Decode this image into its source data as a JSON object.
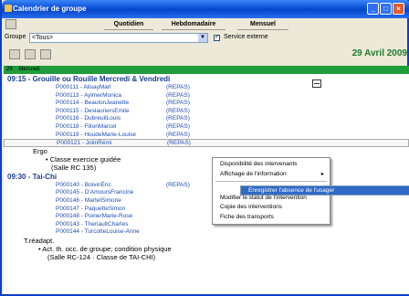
{
  "window": {
    "title": "Calendrier de groupe"
  },
  "views": {
    "daily": "Quotidien",
    "weekly": "Hebdomadaire",
    "monthly": "Mensuel"
  },
  "group": {
    "label": "Groupe",
    "value": "<Tous>",
    "service_label": "Service externe",
    "service_checked": true
  },
  "date": "29 Avril 2009",
  "header_day": {
    "num": "29",
    "name": "Mercredi"
  },
  "sessions": [
    {
      "time": "09:15 - Grouille ou Rouille Mercredi & Vendredi",
      "participants": [
        {
          "id": "P000111 - AlisayMarl",
          "tag": "(REPAS)"
        },
        {
          "id": "P000113 - AylmerMonica",
          "tag": "(REPAS)"
        },
        {
          "id": "P000114 - BeaulonJeanette",
          "tag": "(REPAS)"
        },
        {
          "id": "P000115 - DeslauriersEmile",
          "tag": "(REPAS)"
        },
        {
          "id": "P000116 - DubreuilLouis",
          "tag": "(REPAS)"
        },
        {
          "id": "P000118 - FilionMarcel",
          "tag": "(REPAS)"
        },
        {
          "id": "P000119 - HoudeMarie-Louise",
          "tag": "(REPAS)"
        },
        {
          "id": "P000121 - JolinRémi",
          "tag": "(REPAS)"
        }
      ],
      "staff": "Ergo",
      "notes": [
        "• Classe exercice guidée",
        "(Salle RC 135)"
      ]
    },
    {
      "time": "09:30 - Tai-Chi",
      "participants": [
        {
          "id": "P000140 - BoivinÉric",
          "tag": "(REPAS)"
        },
        {
          "id": "P000145 - D'AmoursFrancine",
          "tag": ""
        },
        {
          "id": "P000146 - MartelSimone",
          "tag": ""
        },
        {
          "id": "P000147 - PaquetteSimon",
          "tag": ""
        },
        {
          "id": "P000148 - PoirierMarie-Rose",
          "tag": ""
        },
        {
          "id": "P000143 - TheriaultCharles",
          "tag": ""
        },
        {
          "id": "P000144 - TurcotteLouise-Anne",
          "tag": ""
        }
      ],
      "staff": "T.réadapt.",
      "notes": [
        "• Act. th. occ. de groupe; condition physique",
        "(Salle RC-124 · Classe de TAI-CHI)"
      ]
    }
  ],
  "context_menu": {
    "items": [
      {
        "label": "Disponibilité des intervenants",
        "sub": false
      },
      {
        "label": "Affichage de l'information",
        "sub": true
      },
      {
        "label": "Enregistrer l'absence de l'usager",
        "sub": false,
        "selected": true
      },
      {
        "label": "Modifier le statut de l'intervention",
        "sub": false
      },
      {
        "label": "Copie des interventions",
        "sub": false
      },
      {
        "label": "Fiche des transports",
        "sub": false
      }
    ]
  }
}
